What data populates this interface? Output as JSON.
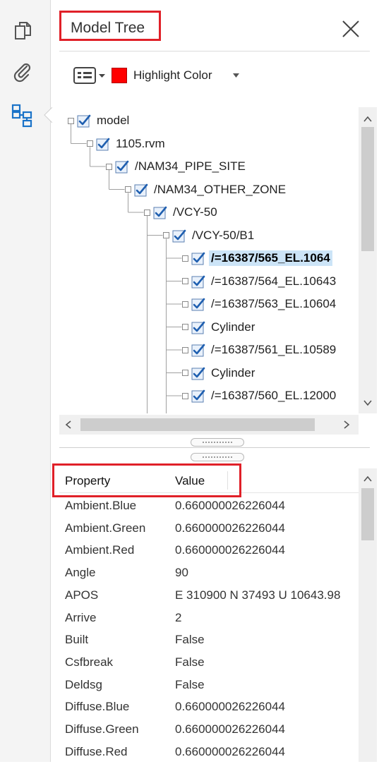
{
  "panel": {
    "title": "Model Tree"
  },
  "toolbar": {
    "highlight_label": "Highlight Color",
    "highlight_color": "#ff0000"
  },
  "tree": {
    "nodes": [
      {
        "label": "model",
        "depth": 0,
        "checked": true,
        "selected": false
      },
      {
        "label": "1105.rvm",
        "depth": 1,
        "checked": true,
        "selected": false
      },
      {
        "label": "/NAM34_PIPE_SITE",
        "depth": 2,
        "checked": true,
        "selected": false
      },
      {
        "label": "/NAM34_OTHER_ZONE",
        "depth": 3,
        "checked": true,
        "selected": false
      },
      {
        "label": "/VCY-50",
        "depth": 4,
        "checked": true,
        "selected": false
      },
      {
        "label": "/VCY-50/B1",
        "depth": 5,
        "checked": true,
        "selected": false
      },
      {
        "label": "/=16387/565_EL.1064",
        "depth": 6,
        "checked": true,
        "selected": true
      },
      {
        "label": "/=16387/564_EL.10643",
        "depth": 6,
        "checked": true,
        "selected": false
      },
      {
        "label": "/=16387/563_EL.10604",
        "depth": 6,
        "checked": true,
        "selected": false
      },
      {
        "label": "Cylinder",
        "depth": 6,
        "checked": true,
        "selected": false
      },
      {
        "label": "/=16387/561_EL.10589",
        "depth": 6,
        "checked": true,
        "selected": false
      },
      {
        "label": "Cylinder",
        "depth": 6,
        "checked": true,
        "selected": false
      },
      {
        "label": "/=16387/560_EL.12000",
        "depth": 6,
        "checked": true,
        "selected": false
      }
    ]
  },
  "properties": {
    "col_property": "Property",
    "col_value": "Value",
    "rows": [
      {
        "name": "Ambient.Blue",
        "value": "0.660000026226044"
      },
      {
        "name": "Ambient.Green",
        "value": "0.660000026226044"
      },
      {
        "name": "Ambient.Red",
        "value": "0.660000026226044"
      },
      {
        "name": "Angle",
        "value": "90"
      },
      {
        "name": "APOS",
        "value": "E 310900 N 37493 U 10643.98"
      },
      {
        "name": "Arrive",
        "value": "2"
      },
      {
        "name": "Built",
        "value": "False"
      },
      {
        "name": "Csfbreak",
        "value": "False"
      },
      {
        "name": "Deldsg",
        "value": "False"
      },
      {
        "name": "Diffuse.Blue",
        "value": "0.660000026226044"
      },
      {
        "name": "Diffuse.Green",
        "value": "0.660000026226044"
      },
      {
        "name": "Diffuse.Red",
        "value": "0.660000026226044"
      }
    ]
  },
  "colors": {
    "accent": "#1a73c8",
    "annotation": "#e02028",
    "selection": "#cce4f7"
  }
}
